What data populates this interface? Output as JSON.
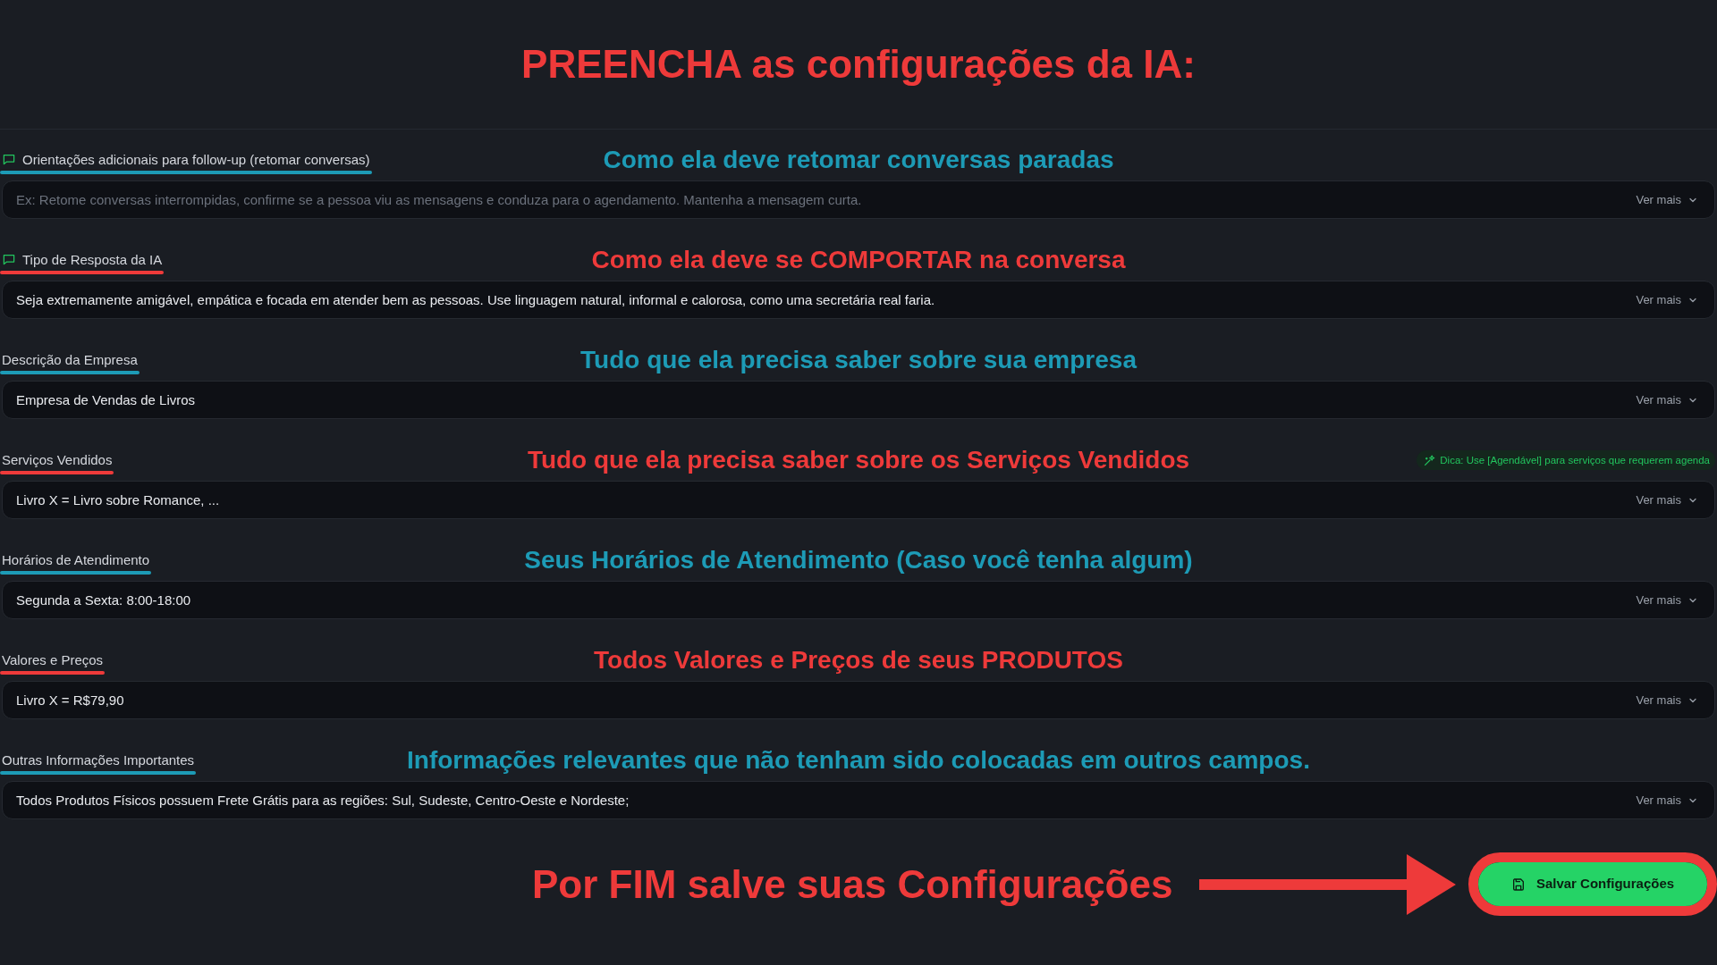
{
  "heading": "PREENCHA as configurações da IA:",
  "fields": [
    {
      "kind": "icon",
      "label": "Orientações adicionais para follow-up (retomar conversas)",
      "annotation": {
        "text": "Como ela deve retomar conversas paradas",
        "color": "#1d9bb6"
      },
      "placeholder": "Ex: Retome conversas interrompidas, confirme se a pessoa viu as mensagens e conduza para o agendamento. Mantenha a mensagem curta.",
      "more_button": "Ver mais"
    },
    {
      "kind": "icon",
      "label": "Tipo de Resposta da IA",
      "annotation": {
        "text": "Como ela deve se COMPORTAR na conversa",
        "color": "#ee3a3a"
      },
      "value": "Seja extremamente amigável, empática e focada em atender bem as pessoas. Use linguagem natural, informal e calorosa, como uma secretária real faria.",
      "more_button": "Ver mais"
    },
    {
      "kind": "plain",
      "label": "Descrição da Empresa",
      "annotation": {
        "text": "Tudo que ela precisa saber sobre sua empresa",
        "color": "#1d9bb6"
      },
      "value": "Empresa de Vendas de Livros",
      "more_button": "Ver mais"
    },
    {
      "kind": "plain",
      "label": "Serviços Vendidos",
      "annotation": {
        "text": "Tudo que ela precisa saber sobre os Serviços Vendidos",
        "color": "#ee3a3a"
      },
      "tip": "Dica: Use [Agendável] para serviços que requerem agenda",
      "value": "Livro X = Livro sobre Romance, ...",
      "more_button": "Ver mais"
    },
    {
      "kind": "plain",
      "label": "Horários de Atendimento",
      "annotation": {
        "text": "Seus Horários de Atendimento (Caso você tenha algum)",
        "color": "#1d9bb6"
      },
      "value": "Segunda a Sexta: 8:00-18:00",
      "more_button": "Ver mais"
    },
    {
      "kind": "plain",
      "label": "Valores e Preços",
      "annotation": {
        "text": "Todos Valores e Preços de seus PRODUTOS",
        "color": "#ee3a3a"
      },
      "value": "Livro X = R$79,90",
      "more_button": "Ver mais"
    },
    {
      "kind": "plain",
      "label": "Outras Informações Importantes",
      "annotation": {
        "text": "Informações relevantes que não tenham sido colocadas em outros campos.",
        "color": "#1d9bb6"
      },
      "value": "Todos Produtos Físicos possuem Frete Grátis para as regiões: Sul, Sudeste, Centro-Oeste e Nordeste;",
      "more_button": "Ver mais"
    }
  ],
  "footer": {
    "note": "Por FIM salve suas Configurações",
    "save_button": "Salvar Configurações"
  }
}
